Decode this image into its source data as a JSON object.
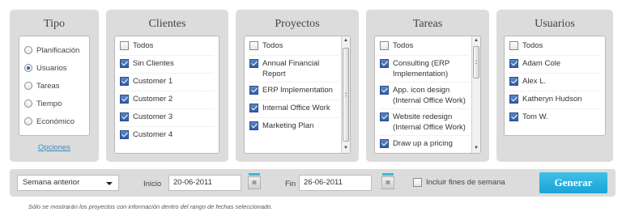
{
  "tipo": {
    "title": "Tipo",
    "options": [
      {
        "label": "Planificación",
        "selected": false
      },
      {
        "label": "Usuarios",
        "selected": true
      },
      {
        "label": "Tareas",
        "selected": false
      },
      {
        "label": "Tiempo",
        "selected": false
      },
      {
        "label": "Económico",
        "selected": false
      }
    ],
    "options_link": "Opciones"
  },
  "clientes": {
    "title": "Clientes",
    "items": [
      {
        "label": "Todos",
        "checked": false
      },
      {
        "label": "Sin Clientes",
        "checked": true
      },
      {
        "label": "Customer 1",
        "checked": true
      },
      {
        "label": "Customer 2",
        "checked": true
      },
      {
        "label": "Customer 3",
        "checked": true
      },
      {
        "label": "Customer 4",
        "checked": true
      }
    ]
  },
  "proyectos": {
    "title": "Proyectos",
    "items": [
      {
        "label": "Todos",
        "checked": false
      },
      {
        "label": "Annual Financial Report",
        "checked": true
      },
      {
        "label": "ERP Implementation",
        "checked": true
      },
      {
        "label": "Internal Office Work",
        "checked": true
      },
      {
        "label": "Marketing Plan",
        "checked": true
      }
    ]
  },
  "tareas": {
    "title": "Tareas",
    "items": [
      {
        "label": "Todos",
        "checked": false
      },
      {
        "label": "Consulting (ERP Implementation)",
        "checked": true
      },
      {
        "label": "App. icon design (Internal Office Work)",
        "checked": true
      },
      {
        "label": "Website redesign (Internal Office Work)",
        "checked": true
      },
      {
        "label": "Draw up a pricing",
        "checked": true
      }
    ]
  },
  "usuarios": {
    "title": "Usuarios",
    "items": [
      {
        "label": "Todos",
        "checked": false
      },
      {
        "label": "Adam Cole",
        "checked": true
      },
      {
        "label": "Alex L.",
        "checked": true
      },
      {
        "label": "Katheryn Hudson",
        "checked": true
      },
      {
        "label": "Tom W.",
        "checked": true
      }
    ]
  },
  "filters": {
    "period_select": "Semana anterior",
    "start_label": "Inicio",
    "start_date": "20-06-2011",
    "end_label": "Fin",
    "end_date": "26-06-2011",
    "weekend_label": "Incluir fines de semana",
    "weekend_checked": false,
    "generate_label": "Generar"
  },
  "footnote": "Sólo se mostrarán los proyectos con información dentro del rango de fechas seleccionado.",
  "colors": {
    "panel_bg": "#dcdcdc",
    "accent": "#1aa4d6",
    "link": "#3a8dc5",
    "checkbox_checked": "#2f5ea8"
  }
}
